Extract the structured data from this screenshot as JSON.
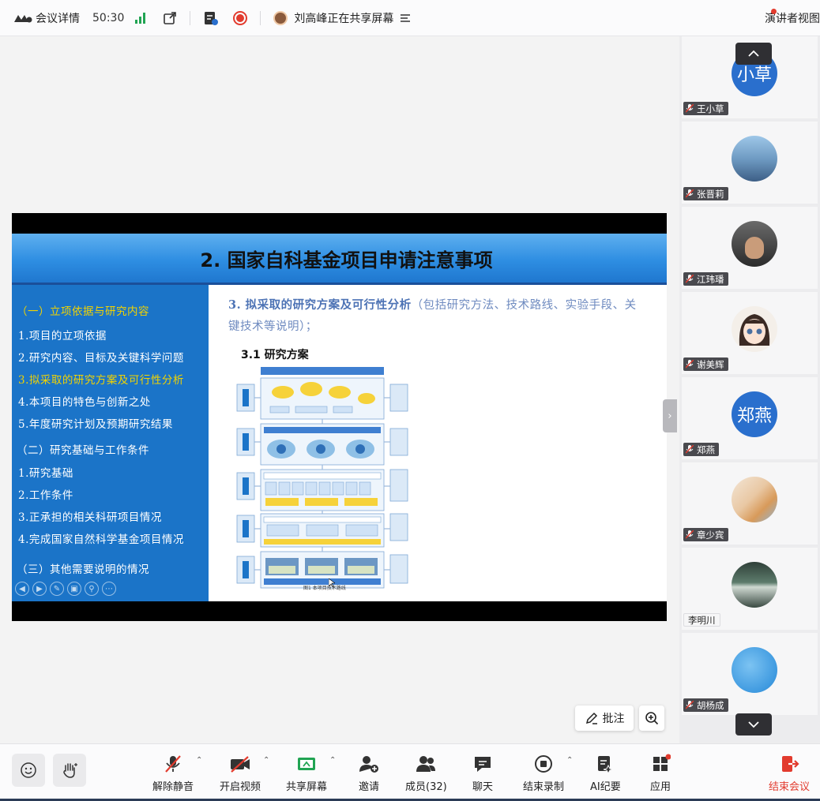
{
  "topbar": {
    "title": "会议详情",
    "timer": "50:30",
    "sharing_text": "刘高峰正在共享屏幕",
    "speaker_view": "演讲者视图"
  },
  "slide": {
    "header_title": "2. 国家自科基金项目申请注意事项",
    "left_menu": [
      {
        "text": "（一）立项依据与研究内容",
        "highlight": true
      },
      {
        "text": "1.项目的立项依据",
        "highlight": false
      },
      {
        "text": "2.研究内容、目标及关键科学问题",
        "highlight": false
      },
      {
        "text": "3.拟采取的研究方案及可行性分析",
        "highlight": true
      },
      {
        "text": "4.本项目的特色与创新之处",
        "highlight": false
      },
      {
        "text": "5.年度研究计划及预期研究结果",
        "highlight": false
      },
      {
        "text": "（二）研究基础与工作条件",
        "highlight": false
      },
      {
        "text": "1.研究基础",
        "highlight": false
      },
      {
        "text": "2.工作条件",
        "highlight": false
      },
      {
        "text": "3.正承担的相关科研项目情况",
        "highlight": false
      },
      {
        "text": "4.完成国家自然科学基金项目情况",
        "highlight": false
      },
      {
        "text": "（三）其他需要说明的情况",
        "highlight": false
      }
    ],
    "lead_bold": "3. 拟采取的研究方案及可行性分析",
    "lead_rest": "（包括研究方法、技术路线、实验手段、关键技术等说明）；",
    "subheading": "3.1  研究方案",
    "figure_caption": "图1  本项目技术路线"
  },
  "annotate_label": "批注",
  "participants": [
    {
      "name": "王小草",
      "avatar_text": "小草",
      "avatar_color": "#2a6fcd",
      "muted": true
    },
    {
      "name": "张晋莉",
      "avatar_text": "",
      "avatar_color": "#6a9cc6",
      "muted": true
    },
    {
      "name": "江玮璠",
      "avatar_text": "",
      "avatar_color": "#4a4a4a",
      "muted": true
    },
    {
      "name": "谢美辉",
      "avatar_text": "",
      "avatar_color": "#f2eee8",
      "muted": true
    },
    {
      "name": "郑燕",
      "avatar_text": "郑燕",
      "avatar_color": "#2a6fcd",
      "muted": true
    },
    {
      "name": "章少宾",
      "avatar_text": "",
      "avatar_color": "#e8d6c2",
      "muted": true
    },
    {
      "name": "李明川",
      "avatar_text": "",
      "avatar_color": "#3c5a4e",
      "muted": false
    },
    {
      "name": "胡杨成",
      "avatar_text": "",
      "avatar_color": "#4aa3e6",
      "muted": true
    }
  ],
  "toolbar": {
    "unmute": "解除静音",
    "start_video": "开启视频",
    "share_screen": "共享屏幕",
    "invite": "邀请",
    "members": "成员(32)",
    "chat": "聊天",
    "stop_recording": "结束录制",
    "ai_notes": "AI纪要",
    "apps": "应用",
    "end_meeting": "结束会议"
  },
  "colors": {
    "accent_blue": "#1b74c8",
    "highlight_yellow": "#f2d300",
    "danger_red": "#e23b2e",
    "signal_green": "#21a453"
  }
}
